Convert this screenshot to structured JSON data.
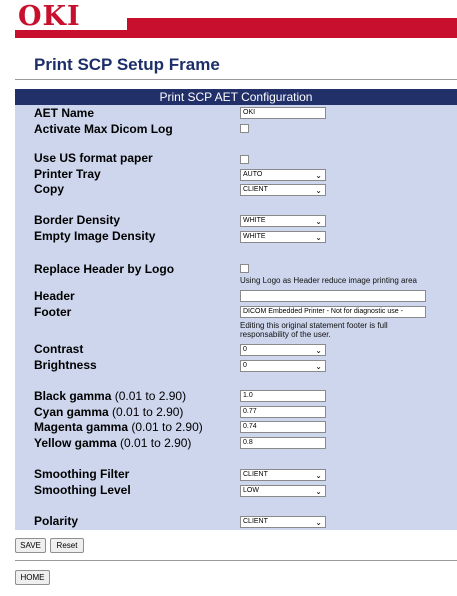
{
  "brand": {
    "logo_text": "OKI",
    "color": "#c8102e"
  },
  "page_title": "Print SCP Setup Frame",
  "panel_header": "Print SCP AET Configuration",
  "fields": {
    "aet_name": {
      "label": "AET Name",
      "value": "OKI"
    },
    "activate_max_dicom_log": {
      "label": "Activate Max Dicom Log",
      "checked": false
    },
    "use_us_format_paper": {
      "label": "Use US format paper",
      "checked": false
    },
    "printer_tray": {
      "label": "Printer Tray",
      "value": "AUTO"
    },
    "copy": {
      "label": "Copy",
      "value": "CLIENT"
    },
    "border_density": {
      "label": "Border Density",
      "value": "WHITE"
    },
    "empty_image_density": {
      "label": "Empty Image Density",
      "value": "WHITE"
    },
    "replace_header_by_logo": {
      "label": "Replace Header by Logo",
      "checked": false,
      "note": "Using Logo as Header reduce image printing area"
    },
    "header": {
      "label": "Header",
      "value": ""
    },
    "footer": {
      "label": "Footer",
      "value": "DICOM Embedded Printer  -  Not for diagnostic use  -",
      "note_line1": "Editing this original statement footer is full",
      "note_line2": "responsability of the user."
    },
    "contrast": {
      "label": "Contrast",
      "value": "0"
    },
    "brightness": {
      "label": "Brightness",
      "value": "0"
    },
    "black_gamma": {
      "label": "Black gamma",
      "range": "(0.01 to 2.90)",
      "value": "1.0"
    },
    "cyan_gamma": {
      "label": "Cyan gamma",
      "range": "(0.01 to 2.90)",
      "value": "0.77"
    },
    "magenta_gamma": {
      "label": "Magenta gamma",
      "range": "(0.01 to 2.90)",
      "value": "0.74"
    },
    "yellow_gamma": {
      "label": "Yellow gamma",
      "range": "(0.01 to 2.90)",
      "value": "0.8"
    },
    "smoothing_filter": {
      "label": "Smoothing Filter",
      "value": "CLIENT"
    },
    "smoothing_level": {
      "label": "Smoothing Level",
      "value": "LOW"
    },
    "polarity": {
      "label": "Polarity",
      "value": "CLIENT"
    }
  },
  "buttons": {
    "save": "SAVE",
    "reset": "Reset",
    "home": "HOME"
  },
  "icons": {
    "dropdown": "chevron-down-icon"
  },
  "colors": {
    "panel_bg": "#cdd6ec",
    "header_bg": "#22306a",
    "title": "#1d2f6a"
  }
}
